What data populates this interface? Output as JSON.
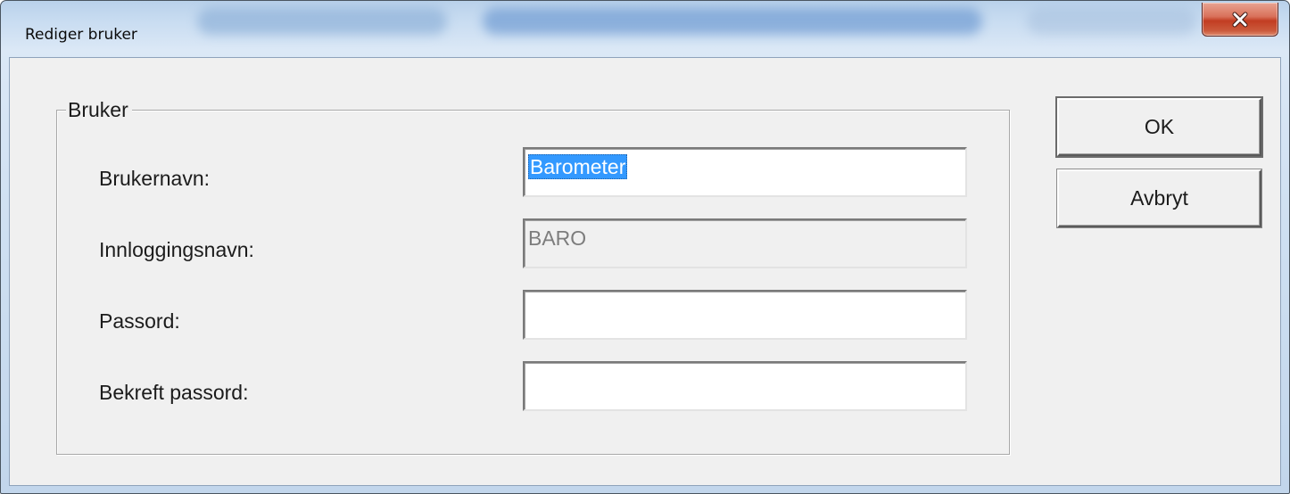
{
  "window": {
    "title": "Rediger bruker",
    "close_icon": "close-icon"
  },
  "group": {
    "legend": "Bruker"
  },
  "fields": {
    "username": {
      "label": "Brukernavn:",
      "value": "Barometer"
    },
    "login_name": {
      "label": "Innloggingsnavn:",
      "value": "BARO"
    },
    "password": {
      "label": "Passord:",
      "value": ""
    },
    "confirm_password": {
      "label": "Bekreft passord:",
      "value": ""
    }
  },
  "buttons": {
    "ok": "OK",
    "cancel": "Avbryt"
  },
  "colors": {
    "selection": "#3399ff",
    "close_button": "#c23d22",
    "dialog_face": "#f0f0f0"
  }
}
